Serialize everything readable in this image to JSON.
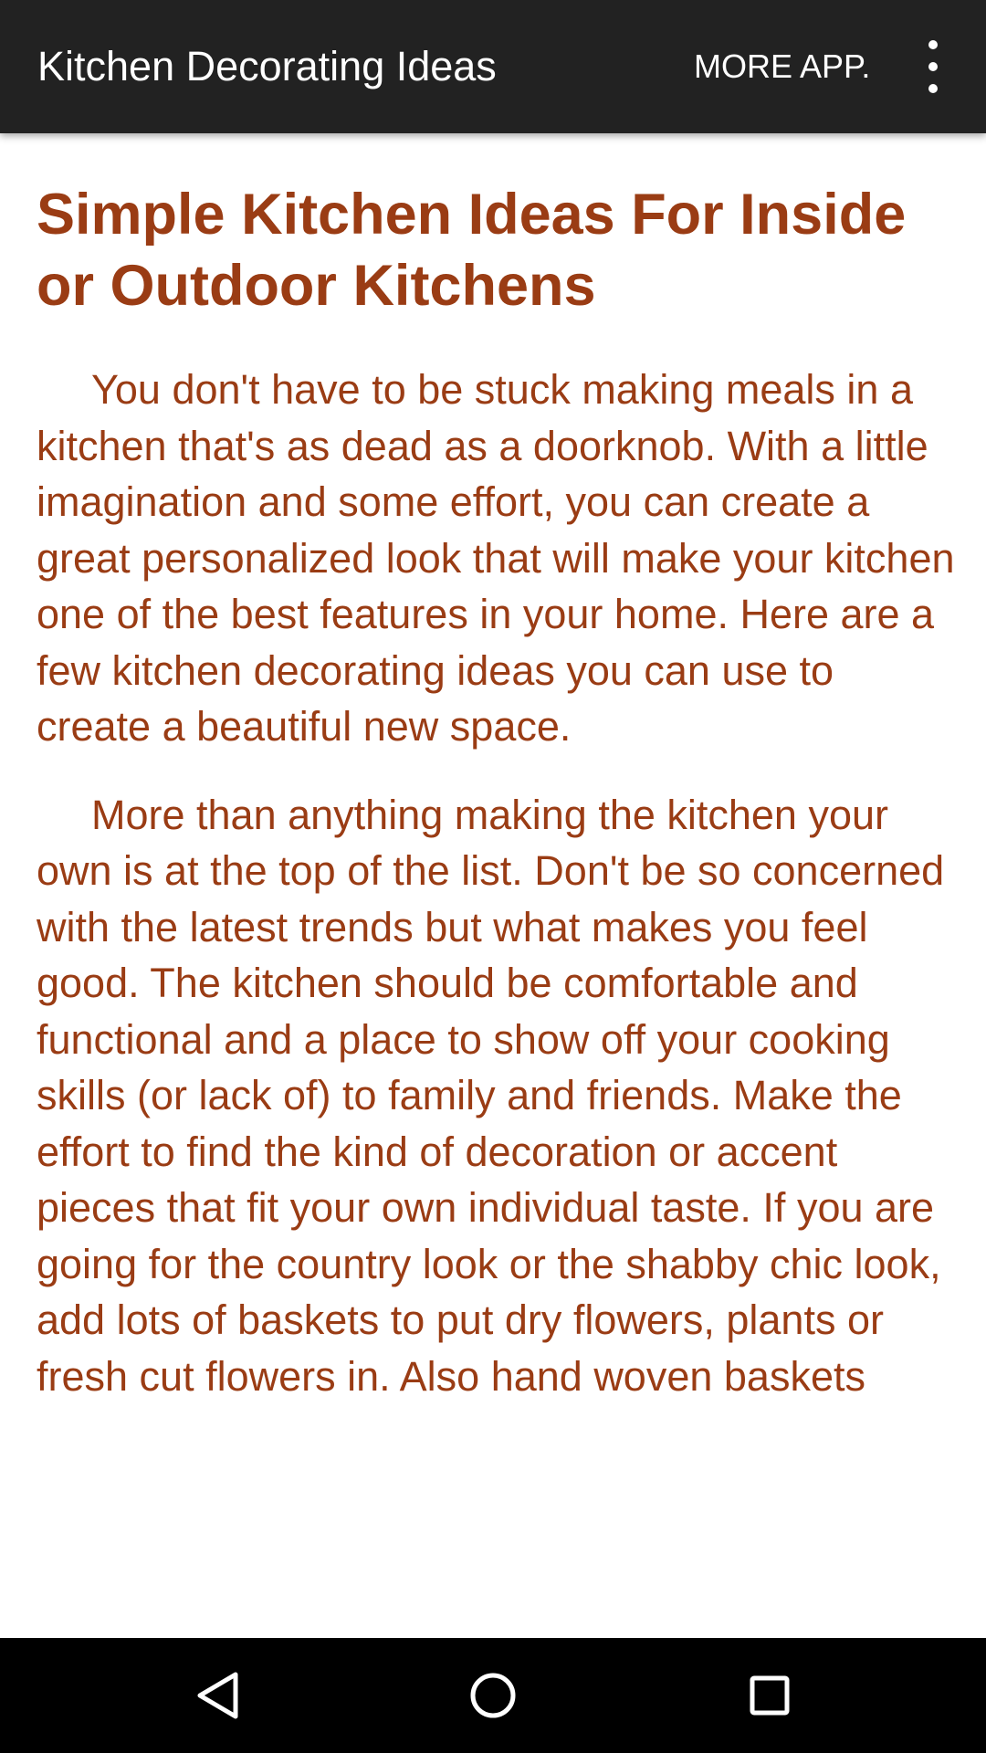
{
  "appbar": {
    "title": "Kitchen Decorating Ideas",
    "more_app_label": "MORE APP."
  },
  "article": {
    "heading": "Simple Kitchen Ideas For Inside or Outdoor Kitchens",
    "paragraphs": [
      "You don't have to be stuck making meals in a kitchen that's as dead as a doorknob. With a little imagination and some effort, you can create a great person­alized look that will make your  kitchen one of the best features in your home. Here are a few kitchen decorating ideas you can use to create a beautiful new space.",
      "More than anything making the kitchen your own is at the top of the list.  Don't be so concerned with the latest trends but what makes you feel good.  The kitchen should be comfortable and functional and a place to show off your cooking skills (or lack of) to family and friends. Make the effort to find the kind of decoration or accent pieces that fit your own individual taste. If you are going for the country look or the shabby chic look, add lots of baskets to put dry flowers, plants or fresh cut flowers in. Also hand woven baskets"
    ]
  },
  "icons": {
    "overflow": "overflow-menu-icon",
    "back": "back-icon",
    "home": "home-icon",
    "recents": "recents-icon"
  },
  "colors": {
    "appbar_bg": "#222222",
    "text_accent": "#9a3c14",
    "navbar_bg": "#000000"
  }
}
